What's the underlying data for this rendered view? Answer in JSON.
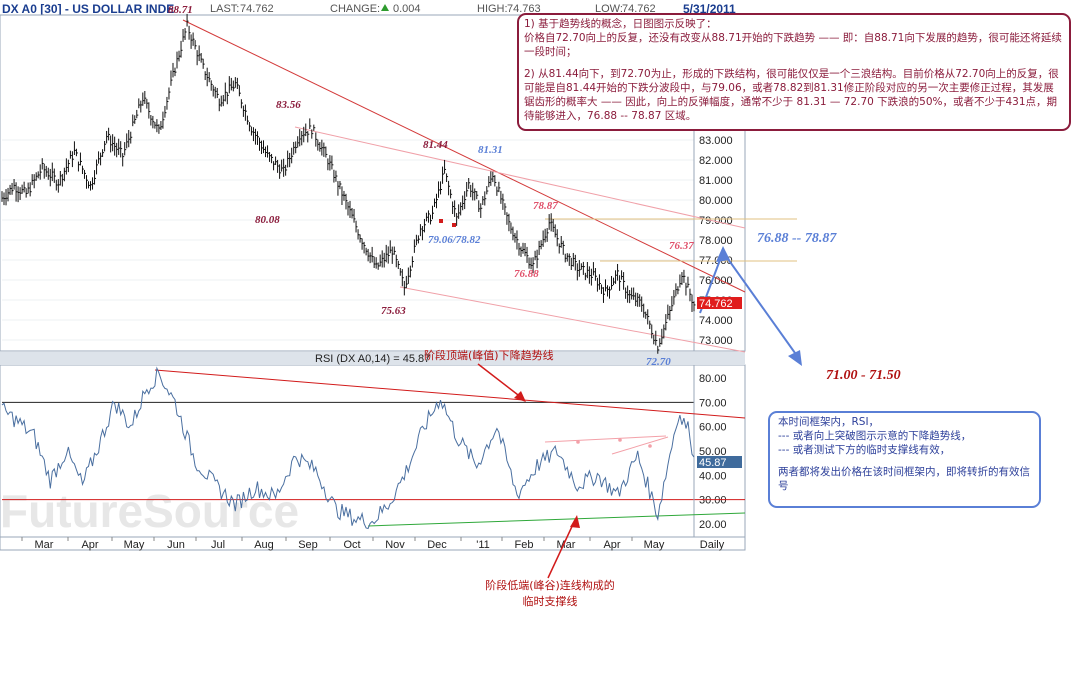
{
  "header": {
    "symbol": "DX A0 [30] - US DOLLAR INDE",
    "last_label": "LAST:",
    "last_value": "74.762",
    "change_label": "CHANGE:",
    "change_value": "0.004",
    "high_label": "HIGH:",
    "high_value": "74.763",
    "low_label": "LOW:",
    "low_value": "74.762",
    "date": "5/31/2011"
  },
  "watermark": "FutureSource",
  "rsi_title": "RSI (DX A0,14) = 45.87",
  "price_badge": "74.762",
  "rsi_badge": "45.87",
  "annotations": {
    "peak": "88.71",
    "p8356": "83.56",
    "p8008": "80.08",
    "p8144": "81.44",
    "p8131": "81.31",
    "p7563": "75.63",
    "p7906": "79.06/78.82",
    "p7887": "78.87",
    "p7688": "76.88",
    "p7637": "76.37",
    "p7270": "72.70",
    "target_up": "76.88 -- 78.87",
    "target_down": "71.00 - 71.50"
  },
  "captions": {
    "top_trend": "阶段顶端(峰值)下降趋势线",
    "support_line1": "阶段低端(峰谷)连线构成的",
    "support_line2": "临时支撑线"
  },
  "note1": {
    "l1": "1) 基于趋势线的概念，日图图示反映了：",
    "l2": "价格自72.70向上的反复，还没有改变从88.71开始的下跌趋势 —— 即：自88.71向下发展的趋势，很可能还将延续一段时间；",
    "l3": "2) 从81.44向下，到72.70为止，形成的下跌结构，很可能仅仅是一个三浪结构。目前价格从72.70向上的反复，很可能是自81.44开始的下跌分波段中，与79.06，或者78.82到81.31修正阶段对应的另一次主要修正过程，其发展锯齿形的概率大 —— 因此，向上的反弹幅度，通常不少于 81.31 — 72.70 下跌浪的50%，或者不少于431点，期待能够进入，76.88 -- 78.87 区域。"
  },
  "note2": {
    "l1": "本时间框架内，RSI，",
    "l2": "--- 或者向上突破图示示意的下降趋势线，",
    "l3": "--- 或者测试下方的临时支撑线有效，",
    "l4": "两者都将发出价格在该时间框架内，即将转折的有效信号"
  },
  "chart_data": [
    {
      "type": "line",
      "title": "DX A0 [30] - US DOLLAR INDE",
      "y_ticks": [
        "73.000",
        "74.000",
        "75.000",
        "76.000",
        "77.000",
        "78.000",
        "79.000",
        "80.000",
        "81.000",
        "82.000",
        "83.000"
      ],
      "x_ticks": [
        "Mar",
        "Apr",
        "May",
        "Jun",
        "Jul",
        "Aug",
        "Sep",
        "Oct",
        "Nov",
        "Dec",
        "'11",
        "Feb",
        "Mar",
        "Apr",
        "May",
        "Daily"
      ],
      "anchors": [
        {
          "t": 0,
          "v": 80.1
        },
        {
          "t": 6,
          "v": 80.7
        },
        {
          "t": 12,
          "v": 80.3
        },
        {
          "t": 20,
          "v": 81.6
        },
        {
          "t": 28,
          "v": 80.9
        },
        {
          "t": 36,
          "v": 82.4
        },
        {
          "t": 44,
          "v": 80.7
        },
        {
          "t": 52,
          "v": 83.2
        },
        {
          "t": 60,
          "v": 82.2
        },
        {
          "t": 70,
          "v": 85.1
        },
        {
          "t": 78,
          "v": 83.4
        },
        {
          "t": 86,
          "v": 86.6
        },
        {
          "t": 92,
          "v": 88.71
        },
        {
          "t": 100,
          "v": 86.6
        },
        {
          "t": 108,
          "v": 85.0
        },
        {
          "t": 116,
          "v": 85.8
        },
        {
          "t": 124,
          "v": 83.6
        },
        {
          "t": 132,
          "v": 82.2
        },
        {
          "t": 140,
          "v": 81.4
        },
        {
          "t": 148,
          "v": 83.3
        },
        {
          "t": 154,
          "v": 83.56
        },
        {
          "t": 162,
          "v": 82.0
        },
        {
          "t": 170,
          "v": 80.1
        },
        {
          "t": 178,
          "v": 78.2
        },
        {
          "t": 186,
          "v": 76.6
        },
        {
          "t": 194,
          "v": 77.5
        },
        {
          "t": 200,
          "v": 75.63
        },
        {
          "t": 208,
          "v": 78.6
        },
        {
          "t": 214,
          "v": 79.3
        },
        {
          "t": 220,
          "v": 81.44
        },
        {
          "t": 226,
          "v": 79.06
        },
        {
          "t": 232,
          "v": 80.8
        },
        {
          "t": 238,
          "v": 79.6
        },
        {
          "t": 244,
          "v": 81.31
        },
        {
          "t": 252,
          "v": 78.82
        },
        {
          "t": 258,
          "v": 77.6
        },
        {
          "t": 264,
          "v": 76.7
        },
        {
          "t": 272,
          "v": 78.87
        },
        {
          "t": 280,
          "v": 77.3
        },
        {
          "t": 286,
          "v": 76.6
        },
        {
          "t": 294,
          "v": 76.2
        },
        {
          "t": 300,
          "v": 75.4
        },
        {
          "t": 306,
          "v": 76.3
        },
        {
          "t": 312,
          "v": 75.2
        },
        {
          "t": 318,
          "v": 74.8
        },
        {
          "t": 326,
          "v": 72.7
        },
        {
          "t": 332,
          "v": 74.4
        },
        {
          "t": 338,
          "v": 76.37
        },
        {
          "t": 344,
          "v": 74.762
        }
      ]
    },
    {
      "type": "line",
      "title": "RSI (DX A0,14) = 45.87",
      "y_ticks": [
        "20.00",
        "30.00",
        "40.00",
        "50.00",
        "60.00",
        "70.00",
        "80.00"
      ],
      "anchors": [
        {
          "t": 0,
          "v": 67
        },
        {
          "t": 8,
          "v": 62
        },
        {
          "t": 16,
          "v": 56
        },
        {
          "t": 24,
          "v": 38
        },
        {
          "t": 32,
          "v": 50
        },
        {
          "t": 40,
          "v": 36
        },
        {
          "t": 48,
          "v": 52
        },
        {
          "t": 56,
          "v": 70
        },
        {
          "t": 64,
          "v": 60
        },
        {
          "t": 72,
          "v": 76
        },
        {
          "t": 78,
          "v": 82
        },
        {
          "t": 86,
          "v": 70
        },
        {
          "t": 96,
          "v": 46
        },
        {
          "t": 106,
          "v": 36
        },
        {
          "t": 116,
          "v": 28
        },
        {
          "t": 126,
          "v": 35
        },
        {
          "t": 136,
          "v": 31
        },
        {
          "t": 146,
          "v": 48
        },
        {
          "t": 156,
          "v": 42
        },
        {
          "t": 166,
          "v": 26
        },
        {
          "t": 176,
          "v": 22
        },
        {
          "t": 184,
          "v": 21
        },
        {
          "t": 192,
          "v": 28
        },
        {
          "t": 200,
          "v": 40
        },
        {
          "t": 210,
          "v": 60
        },
        {
          "t": 218,
          "v": 72
        },
        {
          "t": 226,
          "v": 56
        },
        {
          "t": 236,
          "v": 44
        },
        {
          "t": 246,
          "v": 60
        },
        {
          "t": 256,
          "v": 32
        },
        {
          "t": 266,
          "v": 44
        },
        {
          "t": 276,
          "v": 50
        },
        {
          "t": 286,
          "v": 36
        },
        {
          "t": 296,
          "v": 40
        },
        {
          "t": 306,
          "v": 32
        },
        {
          "t": 316,
          "v": 48
        },
        {
          "t": 326,
          "v": 24
        },
        {
          "t": 336,
          "v": 65
        },
        {
          "t": 342,
          "v": 58
        },
        {
          "t": 344,
          "v": 45.87
        }
      ]
    }
  ]
}
